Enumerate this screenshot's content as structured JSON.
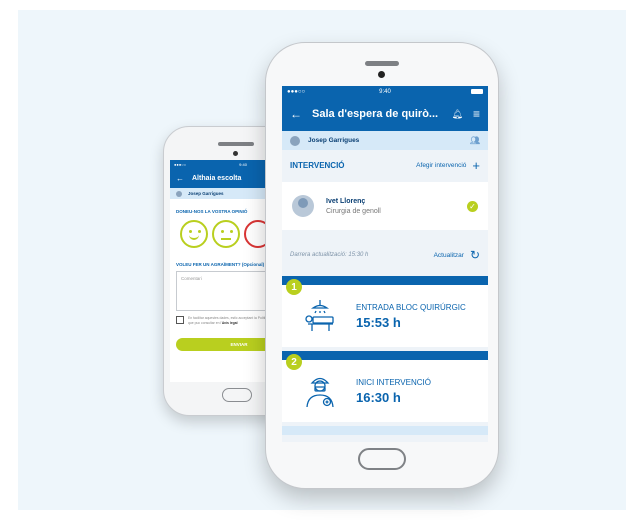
{
  "back_phone": {
    "status": {
      "carrier": "●●●○○",
      "time": "9:40"
    },
    "header": {
      "back_icon": "←",
      "title": "Althaia escolta"
    },
    "user": {
      "name": "Josep Garrigues"
    },
    "question1": "DONEU-NOS LA VOSTRA OPINIÓ",
    "question2": "VOLEU FER UN AGRAÏMENT? (Opcional)",
    "comment_placeholder": "Comentari",
    "legal_text": "En facilitar aquestes dades, estic acceptant la Política de privacitat d'Althaia que puc consultar en l'",
    "legal_link": "Avís legal",
    "send_label": "ENVIAR"
  },
  "front_phone": {
    "status": {
      "carrier": "●●●○○",
      "time": "9:40"
    },
    "header": {
      "back_icon": "←",
      "title": "Sala d'espera de quirò...",
      "bell_icon": "bell-icon",
      "menu_icon": "menu-icon"
    },
    "user": {
      "name": "Josep Garrigues"
    },
    "intervention": {
      "label": "INTERVENCIÓ",
      "add_label": "Afegir intervenció"
    },
    "patient": {
      "name": "Ivet Llorenç",
      "procedure": "Cirurgia de genoll"
    },
    "update": {
      "last": "Darrera actualització: 15:30 h",
      "action": "Actualitzar"
    },
    "steps": [
      {
        "number": "1",
        "name": "ENTRADA BLOC QUIRÚRGIC",
        "time": "15:53 h"
      },
      {
        "number": "2",
        "name": "INICI INTERVENCIÓ",
        "time": "16:30 h"
      }
    ]
  },
  "colors": {
    "primary": "#0a64ae",
    "accent": "#b9cf1f",
    "light": "#d6e9f8",
    "danger": "#d93535"
  }
}
